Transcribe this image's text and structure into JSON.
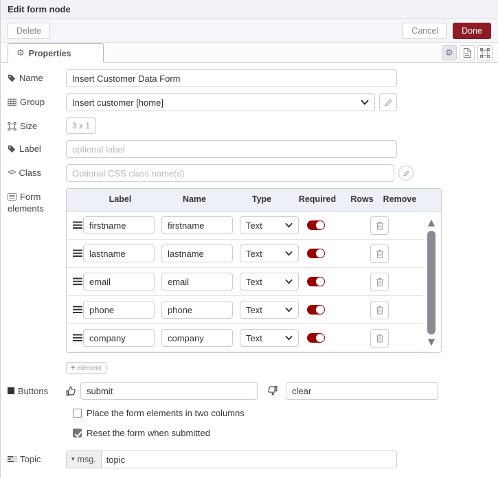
{
  "colors": {
    "accent": "#8C1B23",
    "toggle_on": "#990000",
    "table_header_bg": "#eef0f7"
  },
  "dialog": {
    "title": "Edit form node",
    "delete_label": "Delete",
    "cancel_label": "Cancel",
    "done_label": "Done"
  },
  "tabs": {
    "properties_label": "Properties"
  },
  "icons": {
    "gear": "⚙",
    "caret_down": "▾",
    "scroll_up": "▲",
    "scroll_down": "▼",
    "code": "</>",
    "plus": "+"
  },
  "fields": {
    "name": {
      "label": "Name",
      "value": "Insert Customer Data Form"
    },
    "group": {
      "label": "Group",
      "value": "Insert customer [home]"
    },
    "size": {
      "label": "Size",
      "value": "3 x 1"
    },
    "label": {
      "label": "Label",
      "placeholder": "optional label"
    },
    "class": {
      "label": "Class",
      "placeholder": "Optional CSS class name(s)"
    }
  },
  "form_elements": {
    "label_line1": "Form",
    "label_line2": "elements",
    "columns": [
      "Label",
      "Name",
      "Type",
      "Required",
      "Rows",
      "Remove"
    ],
    "rows": [
      {
        "label": "firstname",
        "name": "firstname",
        "type": "Text",
        "required": true
      },
      {
        "label": "lastname",
        "name": "lastname",
        "type": "Text",
        "required": true
      },
      {
        "label": "email",
        "name": "email",
        "type": "Text",
        "required": true
      },
      {
        "label": "phone",
        "name": "phone",
        "type": "Text",
        "required": true
      },
      {
        "label": "company",
        "name": "company",
        "type": "Text",
        "required": true
      }
    ],
    "add_button_label": "element"
  },
  "buttons_row": {
    "label": "Buttons",
    "submit_value": "submit",
    "clear_value": "clear"
  },
  "checkboxes": [
    {
      "label": "Place the form elements in two columns",
      "checked": false
    },
    {
      "label": "Reset the form when submitted",
      "checked": true
    }
  ],
  "topic": {
    "label": "Topic",
    "prop": "msg.",
    "value": "topic"
  }
}
